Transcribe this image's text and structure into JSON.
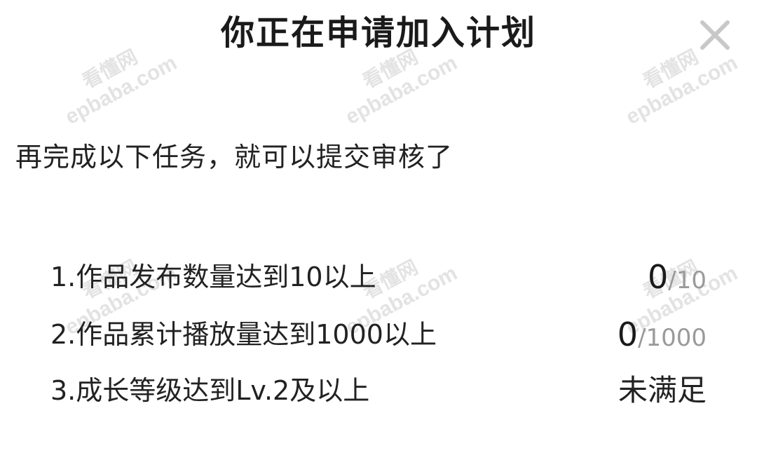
{
  "dialog": {
    "title": "你正在申请加入计划",
    "close_icon": "close-icon",
    "subtitle": "再完成以下任务，就可以提交审核了"
  },
  "tasks": [
    {
      "label": "1.作品发布数量达到10以上",
      "current": "0",
      "target": "/10",
      "current_value": 0,
      "target_value": 10
    },
    {
      "label": "2.作品累计播放量达到1000以上",
      "current": "0",
      "target": "/1000",
      "current_value": 0,
      "target_value": 1000
    },
    {
      "label": "3.成长等级达到Lv.2及以上",
      "status": "未满足"
    }
  ],
  "watermark": {
    "site_cn": "看懂网",
    "site_en": "epbaba.com"
  },
  "colors": {
    "background": "#ffffff",
    "text": "#222222",
    "muted": "#9a9a9a",
    "watermark": "#e3e3e3"
  }
}
